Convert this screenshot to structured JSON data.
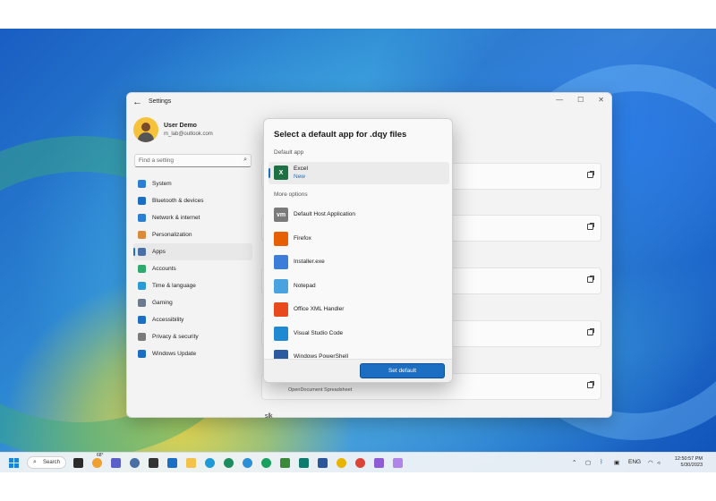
{
  "settings": {
    "title": "Settings",
    "user": {
      "name": "User Demo",
      "email": "m_lab@outlook.com"
    },
    "search_placeholder": "Find a setting",
    "nav": [
      {
        "label": "System",
        "icon": "monitor-icon",
        "color": "#2a7fd4"
      },
      {
        "label": "Bluetooth & devices",
        "icon": "bluetooth-icon",
        "color": "#1b6ec2"
      },
      {
        "label": "Network & internet",
        "icon": "wifi-icon",
        "color": "#2a7fd4"
      },
      {
        "label": "Personalization",
        "icon": "brush-icon",
        "color": "#d98b3a"
      },
      {
        "label": "Apps",
        "icon": "apps-icon",
        "color": "#4a6fa5",
        "active": true
      },
      {
        "label": "Accounts",
        "icon": "person-icon",
        "color": "#2eaa6e"
      },
      {
        "label": "Time & language",
        "icon": "globe-icon",
        "color": "#2a9bd4"
      },
      {
        "label": "Gaming",
        "icon": "controller-icon",
        "color": "#6b7a8c"
      },
      {
        "label": "Accessibility",
        "icon": "accessibility-icon",
        "color": "#1b6ec2"
      },
      {
        "label": "Privacy & security",
        "icon": "shield-icon",
        "color": "#7a7a7a"
      },
      {
        "label": "Windows Update",
        "icon": "update-icon",
        "color": "#1b6ec2"
      }
    ],
    "bottom_card_sub": "OpenDocument Spreadsheet"
  },
  "dialog": {
    "title": "Select a default app for .dqy files",
    "default_section": "Default app",
    "default_app": {
      "name": "Excel",
      "badge": "New",
      "icon": "excel-icon"
    },
    "more_section": "More options",
    "options": [
      {
        "name": "Default Host Application",
        "icon": "vm-icon",
        "glyph": "vm",
        "color": "#7a7a7a"
      },
      {
        "name": "Firefox",
        "icon": "firefox-icon",
        "glyph": "",
        "color": "#e66000"
      },
      {
        "name": "Installer.exe",
        "icon": "installer-icon",
        "glyph": "",
        "color": "#3b7dd8"
      },
      {
        "name": "Notepad",
        "icon": "notepad-icon",
        "glyph": "",
        "color": "#4aa3df"
      },
      {
        "name": "Office XML Handler",
        "icon": "office-icon",
        "glyph": "",
        "color": "#e8491d"
      },
      {
        "name": "Visual Studio Code",
        "icon": "vscode-icon",
        "glyph": "",
        "color": "#1f8ad2"
      },
      {
        "name": "Windows PowerShell",
        "icon": "powershell-icon",
        "glyph": "",
        "color": "#2c5aa0"
      }
    ],
    "set_default_label": "Set default"
  },
  "stray_text": "slk",
  "taskbar": {
    "search_label": "Search",
    "weather_temp": "68°",
    "lang": "ENG",
    "time": "12:50:57 PM",
    "date": "5/30/2023"
  }
}
